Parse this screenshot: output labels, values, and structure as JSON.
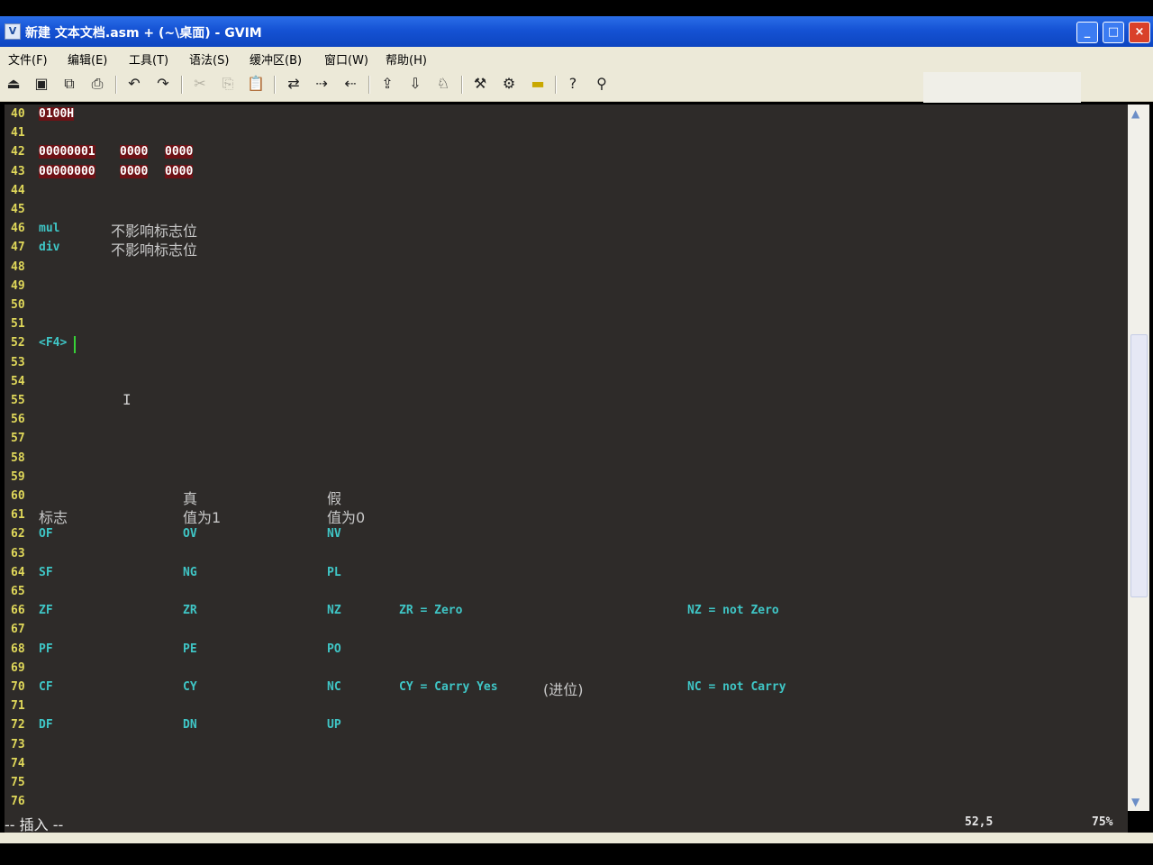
{
  "window": {
    "title": "新建 文本文档.asm + (~\\桌面) - GVIM",
    "app_icon": "vim-icon",
    "controls": {
      "minimize": "_",
      "maximize": "□",
      "close": "×"
    }
  },
  "menu": [
    "文件(F)",
    "编辑(E)",
    "工具(T)",
    "语法(S)",
    "缓冲区(B)",
    "窗口(W)",
    "帮助(H)"
  ],
  "toolbar": [
    {
      "icon": "open-icon",
      "glyph": "⏏"
    },
    {
      "icon": "save-icon",
      "glyph": "▣"
    },
    {
      "icon": "save-all-icon",
      "glyph": "⧉"
    },
    {
      "icon": "print-icon",
      "glyph": "⎙"
    },
    {
      "icon": "undo-icon",
      "glyph": "↶"
    },
    {
      "icon": "redo-icon",
      "glyph": "↷"
    },
    {
      "icon": "cut-icon",
      "glyph": "✂"
    },
    {
      "icon": "copy-icon",
      "glyph": "⎘"
    },
    {
      "icon": "paste-icon",
      "glyph": "📋"
    },
    {
      "icon": "replace-icon",
      "glyph": "⇄"
    },
    {
      "icon": "find-next-icon",
      "glyph": "⇢"
    },
    {
      "icon": "find-prev-icon",
      "glyph": "⇠"
    },
    {
      "icon": "load-session-icon",
      "glyph": "⇪"
    },
    {
      "icon": "save-session-icon",
      "glyph": "⇩"
    },
    {
      "icon": "run-script-icon",
      "glyph": "♘"
    },
    {
      "icon": "make-icon",
      "glyph": "⚒"
    },
    {
      "icon": "shell-icon",
      "glyph": "⚙"
    },
    {
      "icon": "ctags-icon",
      "glyph": "▬"
    },
    {
      "icon": "help-icon",
      "glyph": "?"
    },
    {
      "icon": "find-help-icon",
      "glyph": "⚲"
    }
  ],
  "editor": {
    "lines": [
      {
        "n": "40",
        "segs": [
          {
            "col": 5,
            "text": "0100H",
            "cls": "red"
          }
        ]
      },
      {
        "n": "41",
        "segs": []
      },
      {
        "n": "42",
        "segs": [
          {
            "col": 5,
            "text": "00000001",
            "cls": "red"
          },
          {
            "col": 14,
            "text": "0000",
            "cls": "red"
          },
          {
            "col": 19,
            "text": "0000",
            "cls": "red"
          }
        ]
      },
      {
        "n": "43",
        "segs": [
          {
            "col": 5,
            "text": "00000000",
            "cls": "red"
          },
          {
            "col": 14,
            "text": "0000",
            "cls": "red"
          },
          {
            "col": 19,
            "text": "0000",
            "cls": "red"
          }
        ]
      },
      {
        "n": "44",
        "segs": []
      },
      {
        "n": "45",
        "segs": []
      },
      {
        "n": "46",
        "segs": [
          {
            "col": 5,
            "text": "mul",
            "cls": "cyan"
          },
          {
            "col": 13,
            "text": "不影响标志位",
            "cls": "grey cjk"
          }
        ]
      },
      {
        "n": "47",
        "segs": [
          {
            "col": 5,
            "text": "div",
            "cls": "cyan"
          },
          {
            "col": 13,
            "text": "不影响标志位",
            "cls": "grey cjk"
          }
        ]
      },
      {
        "n": "48",
        "segs": []
      },
      {
        "n": "49",
        "segs": []
      },
      {
        "n": "50",
        "segs": []
      },
      {
        "n": "51",
        "segs": []
      },
      {
        "n": "52",
        "segs": [
          {
            "col": 5,
            "text": "<F4>",
            "cls": "cyan"
          }
        ]
      },
      {
        "n": "53",
        "segs": []
      },
      {
        "n": "54",
        "segs": []
      },
      {
        "n": "55",
        "segs": []
      },
      {
        "n": "56",
        "segs": []
      },
      {
        "n": "57",
        "segs": []
      },
      {
        "n": "58",
        "segs": []
      },
      {
        "n": "59",
        "segs": []
      },
      {
        "n": "60",
        "segs": [
          {
            "col": 21,
            "text": "真",
            "cls": "grey cjk"
          },
          {
            "col": 37,
            "text": "假",
            "cls": "grey cjk"
          }
        ]
      },
      {
        "n": "61",
        "segs": [
          {
            "col": 5,
            "text": "标志",
            "cls": "grey cjk"
          },
          {
            "col": 21,
            "text": "值为1",
            "cls": "grey cjk"
          },
          {
            "col": 37,
            "text": "值为0",
            "cls": "grey cjk"
          }
        ]
      },
      {
        "n": "62",
        "segs": [
          {
            "col": 5,
            "text": "OF",
            "cls": "cyan"
          },
          {
            "col": 21,
            "text": "OV",
            "cls": "cyan"
          },
          {
            "col": 37,
            "text": "NV",
            "cls": "cyan"
          }
        ]
      },
      {
        "n": "63",
        "segs": []
      },
      {
        "n": "64",
        "segs": [
          {
            "col": 5,
            "text": "SF",
            "cls": "cyan"
          },
          {
            "col": 21,
            "text": "NG",
            "cls": "cyan"
          },
          {
            "col": 37,
            "text": "PL",
            "cls": "cyan"
          }
        ]
      },
      {
        "n": "65",
        "segs": []
      },
      {
        "n": "66",
        "segs": [
          {
            "col": 5,
            "text": "ZF",
            "cls": "cyan"
          },
          {
            "col": 21,
            "text": "ZR",
            "cls": "cyan"
          },
          {
            "col": 37,
            "text": "NZ",
            "cls": "cyan"
          },
          {
            "col": 45,
            "text": "ZR = Zero",
            "cls": "cyan"
          },
          {
            "col": 77,
            "text": "NZ = not Zero",
            "cls": "cyan"
          }
        ]
      },
      {
        "n": "67",
        "segs": []
      },
      {
        "n": "68",
        "segs": [
          {
            "col": 5,
            "text": "PF",
            "cls": "cyan"
          },
          {
            "col": 21,
            "text": "PE",
            "cls": "cyan"
          },
          {
            "col": 37,
            "text": "PO",
            "cls": "cyan"
          }
        ]
      },
      {
        "n": "69",
        "segs": []
      },
      {
        "n": "70",
        "segs": [
          {
            "col": 5,
            "text": "CF",
            "cls": "cyan"
          },
          {
            "col": 21,
            "text": "CY",
            "cls": "cyan"
          },
          {
            "col": 37,
            "text": "NC",
            "cls": "cyan"
          },
          {
            "col": 45,
            "text": "CY = Carry Yes",
            "cls": "cyan"
          },
          {
            "col": 61,
            "text": "(进位)",
            "cls": "grey cjk"
          },
          {
            "col": 77,
            "text": "NC = not Carry",
            "cls": "cyan"
          }
        ]
      },
      {
        "n": "71",
        "segs": []
      },
      {
        "n": "72",
        "segs": [
          {
            "col": 5,
            "text": "DF",
            "cls": "cyan"
          },
          {
            "col": 21,
            "text": "DN",
            "cls": "cyan"
          },
          {
            "col": 37,
            "text": "UP",
            "cls": "cyan"
          }
        ]
      },
      {
        "n": "73",
        "segs": []
      },
      {
        "n": "74",
        "segs": []
      },
      {
        "n": "75",
        "segs": []
      },
      {
        "n": "76",
        "segs": []
      }
    ]
  },
  "status": {
    "mode": "-- 插入 --",
    "position": "52,5",
    "percent": "75%"
  }
}
